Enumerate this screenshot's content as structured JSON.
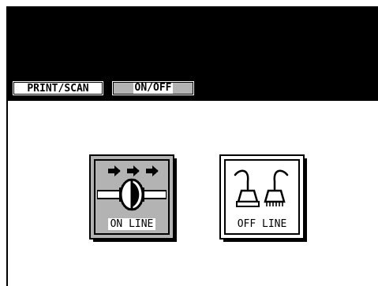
{
  "tabs": [
    {
      "label": "PRINT/SCAN",
      "active": false
    },
    {
      "label": "ON/OFF",
      "active": true
    }
  ],
  "modes": {
    "online": {
      "label": "ON LINE",
      "icon": "network-flow-arrows-icon"
    },
    "offline": {
      "label": "OFF LINE",
      "icon": "disconnected-plug-icon"
    }
  },
  "colors": {
    "background": "#ffffff",
    "band": "#000000",
    "ink": "#000000"
  }
}
